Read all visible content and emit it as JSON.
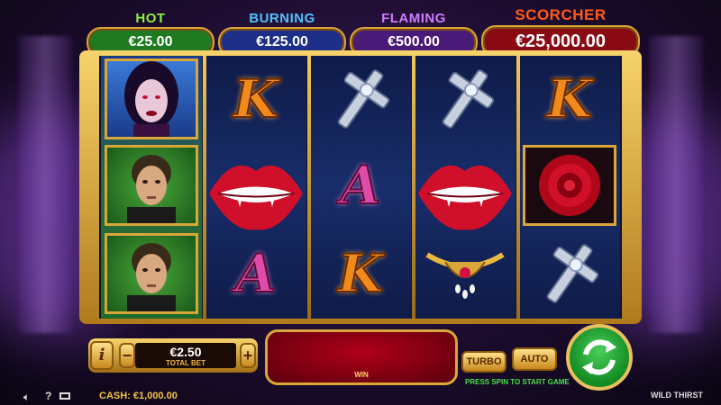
{
  "jackpots": [
    {
      "name": "HOT",
      "amount": "€25.00",
      "title_color": "#8cf23c",
      "box_color": "#1f7a22"
    },
    {
      "name": "BURNING",
      "amount": "€125.00",
      "title_color": "#4fc3ff",
      "box_color": "#1e2f8a"
    },
    {
      "name": "FLAMING",
      "amount": "€500.00",
      "title_color": "#d07bff",
      "box_color": "#4a1a78"
    },
    {
      "name": "SCORCHER",
      "amount": "€25,000.00",
      "title_color": "#ff5a1a",
      "box_color": "#8a0a14"
    }
  ],
  "reels": [
    [
      "vampire-woman",
      "man-portrait",
      "man-portrait"
    ],
    [
      "K",
      "lips",
      "A"
    ],
    [
      "cross",
      "A",
      "K"
    ],
    [
      "cross",
      "lips",
      "necklace"
    ],
    [
      "K",
      "rose",
      "cross"
    ]
  ],
  "controls": {
    "info_label": "i",
    "minus_label": "−",
    "plus_label": "+",
    "bet_value": "€2.50",
    "bet_label": "TOTAL BET",
    "win_label": "WIN",
    "turbo_label": "TURBO",
    "auto_label": "AUTO",
    "press_spin_text": "PRESS SPIN TO START GAME"
  },
  "footer": {
    "cash_label": "CASH:",
    "cash_value": "€1,000.00",
    "game_title": "WILD THIRST"
  },
  "colors": {
    "gold": "#d9a63a",
    "spin_green": "#1fa82e",
    "win_red": "#9a0014",
    "press_spin_green": "#4be04b"
  }
}
